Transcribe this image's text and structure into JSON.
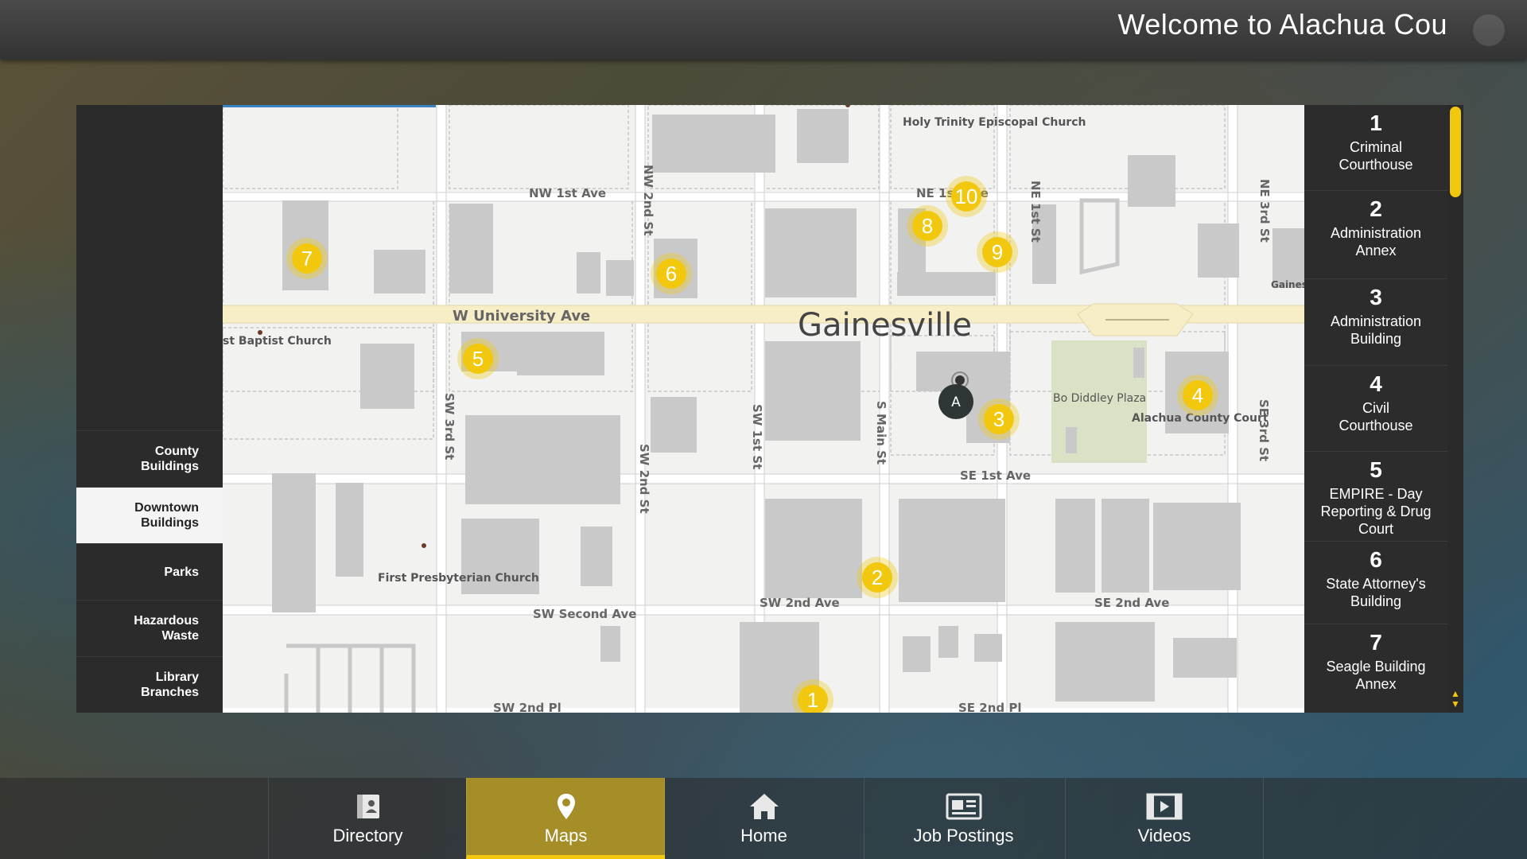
{
  "header": {
    "welcome": "Welcome to Alachua Cou"
  },
  "left_nav": {
    "items": [
      {
        "label": "County\nBuildings",
        "active": false
      },
      {
        "label": "Downtown\nBuildings",
        "active": true
      },
      {
        "label": "Parks",
        "active": false
      },
      {
        "label": "Hazardous\nWaste",
        "active": false
      },
      {
        "label": "Library\nBranches",
        "active": false
      }
    ]
  },
  "map": {
    "city_label": "Gainesville",
    "you_are_here": "A",
    "streets": [
      "NW 1st Ave",
      "W University Ave",
      "NE 1st Ave",
      "SE 1st Ave",
      "SW 2nd Ave",
      "SE 2nd Ave",
      "SW Second Ave",
      "SW 2nd Pl",
      "SE 2nd Pl",
      "NW 2nd St",
      "SW 3rd St",
      "SW 2nd St",
      "SW 1st St",
      "S Main St",
      "NE 1st St",
      "NE 3rd St",
      "SE 3rd St"
    ],
    "places": [
      "Holy Trinity Episcopal Church",
      "st Baptist Church",
      "Bo Diddley Plaza",
      "Alachua County Court",
      "First Presbyterian Church",
      "Gaines of"
    ],
    "markers": [
      "1",
      "2",
      "3",
      "4",
      "5",
      "6",
      "7",
      "8",
      "9",
      "10"
    ]
  },
  "locations": [
    {
      "num": "1",
      "name": "Criminal\nCourthouse"
    },
    {
      "num": "2",
      "name": "Administration\nAnnex"
    },
    {
      "num": "3",
      "name": "Administration\nBuilding"
    },
    {
      "num": "4",
      "name": "Civil\nCourthouse"
    },
    {
      "num": "5",
      "name": "EMPIRE - Day\nReporting & Drug\nCourt"
    },
    {
      "num": "6",
      "name": "State Attorney's\nBuilding"
    },
    {
      "num": "7",
      "name": "Seagle Building\nAnnex"
    }
  ],
  "bottom_nav": [
    {
      "label": "Directory",
      "icon": "directory-icon",
      "active": false
    },
    {
      "label": "Maps",
      "icon": "map-pin-icon",
      "active": true
    },
    {
      "label": "Home",
      "icon": "home-icon",
      "active": false
    },
    {
      "label": "Job Postings",
      "icon": "job-postings-icon",
      "active": false
    },
    {
      "label": "Videos",
      "icon": "videos-icon",
      "active": false
    }
  ],
  "colors": {
    "accent": "#f2c80f",
    "active_tab": "#a58d28",
    "marker": "#f2c80f"
  }
}
